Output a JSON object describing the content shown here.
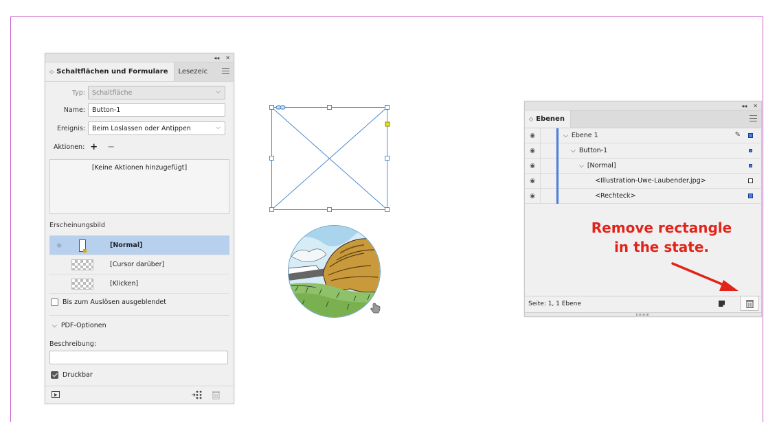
{
  "buttons_panel": {
    "tabs": [
      {
        "label": "Schaltflächen und Formulare"
      },
      {
        "label": "Lesezeic"
      }
    ],
    "typ_label": "Typ:",
    "typ_value": "Schaltfläche",
    "name_label": "Name:",
    "name_value": "Button-1",
    "ereignis_label": "Ereignis:",
    "ereignis_value": "Beim Loslassen oder Antippen",
    "aktionen_label": "Aktionen:",
    "aktionen_empty": "[Keine Aktionen hinzugefügt]",
    "erscheinungsbild_label": "Erscheinungsbild",
    "states": [
      {
        "name": "[Normal]",
        "selected": true
      },
      {
        "name": "[Cursor darüber]",
        "selected": false
      },
      {
        "name": "[Klicken]",
        "selected": false
      }
    ],
    "hidden_until_label": "Bis zum Auslösen ausgeblendet",
    "pdf_options_label": "PDF-Optionen",
    "beschreibung_label": "Beschreibung:",
    "beschreibung_value": "",
    "druckbar_label": "Druckbar"
  },
  "layers_panel": {
    "tab_label": "Ebenen",
    "layers": [
      {
        "name": "Ebene 1",
        "level": 0,
        "expanded": true,
        "marker": "filled"
      },
      {
        "name": "Button-1",
        "level": 1,
        "expanded": true,
        "marker": "small"
      },
      {
        "name": "[Normal]",
        "level": 2,
        "expanded": true,
        "marker": "small"
      },
      {
        "name": "<Illustration-Uwe-Laubender.jpg>",
        "level": 3,
        "expanded": false,
        "marker": "hollow"
      },
      {
        "name": "<Rechteck>",
        "level": 3,
        "expanded": false,
        "marker": "filled"
      }
    ],
    "status": "Seite: 1, 1 Ebene"
  },
  "annotation": {
    "line1": "Remove rectangle",
    "line2": "in the state."
  },
  "colors": {
    "annotation": "#e2231a",
    "selection_blue": "#4a80e0",
    "page_border": "#c85ac8"
  }
}
